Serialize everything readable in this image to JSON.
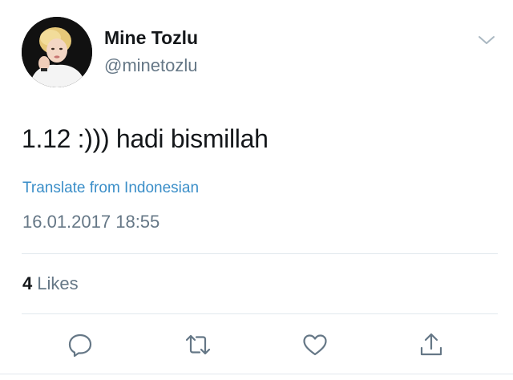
{
  "author": {
    "display_name": "Mine Tozlu",
    "handle": "@minetozlu",
    "avatar_icon": "profile-photo"
  },
  "tweet": {
    "text": "1.12 :))) hadi bismillah",
    "translate_label": "Translate from Indonesian",
    "timestamp": "16.01.2017 18:55"
  },
  "stats": {
    "likes_count": "4",
    "likes_label": "Likes"
  },
  "actions": [
    {
      "name": "reply",
      "icon": "speech-bubble-icon"
    },
    {
      "name": "retweet",
      "icon": "retweet-arrows-icon"
    },
    {
      "name": "like",
      "icon": "heart-icon"
    },
    {
      "name": "share",
      "icon": "share-upload-icon"
    }
  ],
  "colors": {
    "link": "#3a8ec8",
    "secondary_text": "#657786",
    "icon": "#657786",
    "divider": "#e1e8ed"
  }
}
